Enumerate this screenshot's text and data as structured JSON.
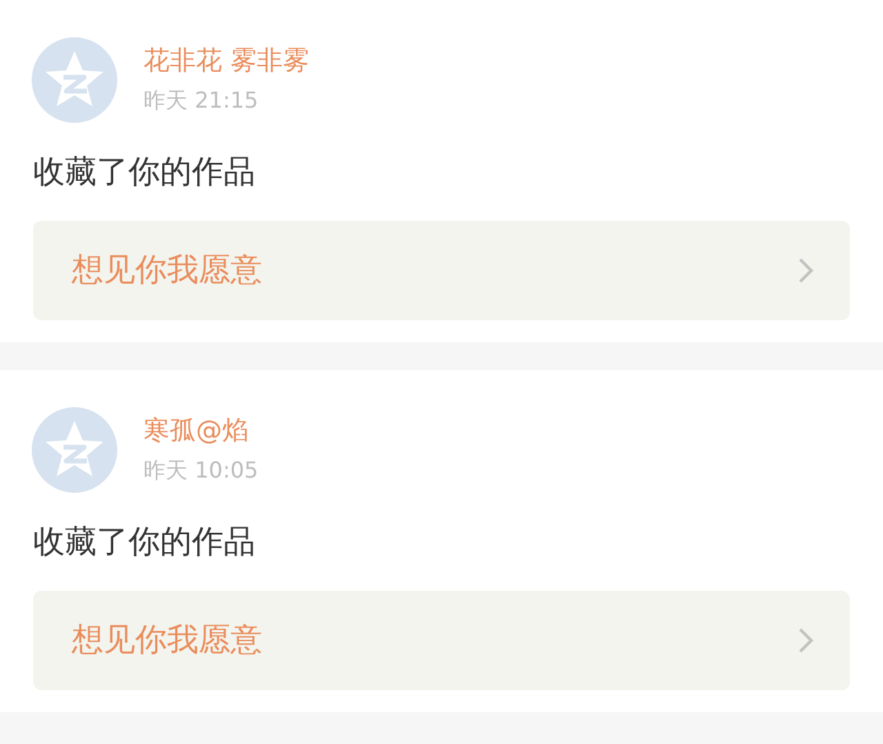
{
  "notifications": [
    {
      "name": "花非花 雾非雾",
      "time": "昨天 21:15",
      "action": "收藏了你的作品",
      "work": {
        "title": "想见你我愿意"
      }
    },
    {
      "name": "寒孤@焰",
      "time": "昨天 10:05",
      "action": "收藏了你的作品",
      "work": {
        "title": "想见你我愿意"
      }
    }
  ]
}
